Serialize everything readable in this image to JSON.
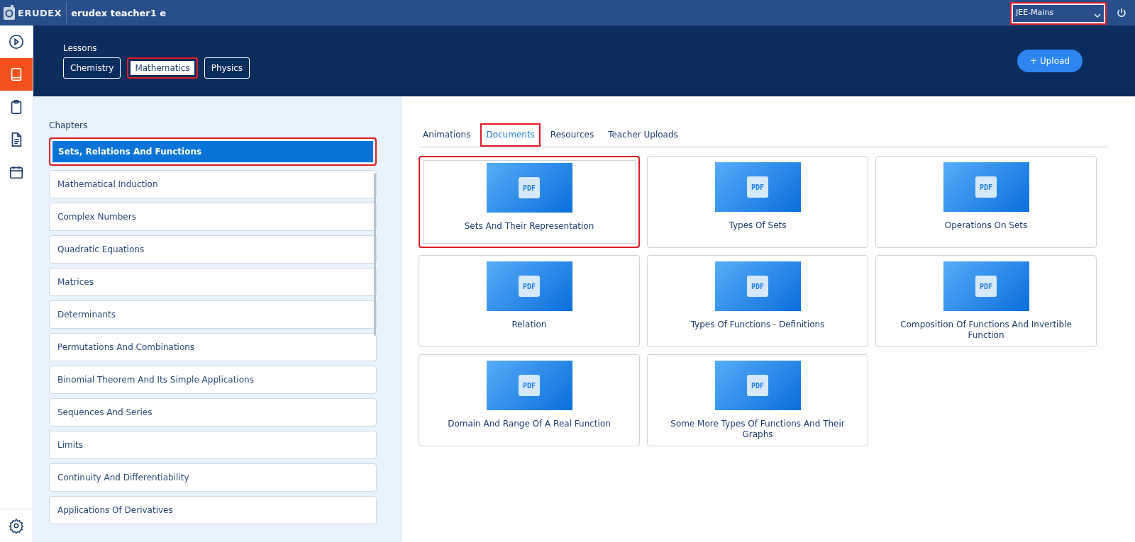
{
  "top_bar": {
    "logo": "ERUDEX",
    "user": "erudex teacher1 e",
    "exam_select": {
      "value": "JEE-Mains",
      "highlighted": true
    }
  },
  "sidebar": {
    "items": [
      {
        "kind": "play",
        "selected": false
      },
      {
        "kind": "book",
        "selected": true
      },
      {
        "kind": "clipboard",
        "selected": false
      },
      {
        "kind": "document",
        "selected": false
      },
      {
        "kind": "calendar",
        "selected": false
      }
    ]
  },
  "lessons": {
    "title": "Lessons",
    "subjects": [
      {
        "label": "Chemistry",
        "selected": false,
        "highlighted": false
      },
      {
        "label": "Mathematics",
        "selected": true,
        "highlighted": true
      },
      {
        "label": "Physics",
        "selected": false,
        "highlighted": false
      }
    ],
    "upload_button": "+ Upload"
  },
  "chapters": {
    "title": "Chapters",
    "items": [
      {
        "label": "Sets, Relations And Functions",
        "selected": true,
        "highlighted": true
      },
      {
        "label": "Mathematical Induction",
        "selected": false,
        "highlighted": false
      },
      {
        "label": "Complex Numbers",
        "selected": false,
        "highlighted": false
      },
      {
        "label": "Quadratic Equations",
        "selected": false,
        "highlighted": false
      },
      {
        "label": "Matrices",
        "selected": false,
        "highlighted": false
      },
      {
        "label": "Determinants",
        "selected": false,
        "highlighted": false
      },
      {
        "label": "Permutations And Combinations",
        "selected": false,
        "highlighted": false
      },
      {
        "label": "Binomial Theorem And Its Simple Applications",
        "selected": false,
        "highlighted": false
      },
      {
        "label": "Sequences And Series",
        "selected": false,
        "highlighted": false
      },
      {
        "label": "Limits",
        "selected": false,
        "highlighted": false
      },
      {
        "label": "Continuity And Differentiability",
        "selected": false,
        "highlighted": false
      },
      {
        "label": "Applications Of Derivatives",
        "selected": false,
        "highlighted": false
      }
    ]
  },
  "content_tabs": [
    {
      "label": "Animations",
      "selected": false,
      "highlighted": false
    },
    {
      "label": "Documents",
      "selected": true,
      "highlighted": true
    },
    {
      "label": "Resources",
      "selected": false,
      "highlighted": false
    },
    {
      "label": "Teacher Uploads",
      "selected": false,
      "highlighted": false
    }
  ],
  "documents": [
    {
      "badge": "PDF",
      "title": "Sets And Their Representation",
      "highlighted": true
    },
    {
      "badge": "PDF",
      "title": "Types Of Sets",
      "highlighted": false
    },
    {
      "badge": "PDF",
      "title": "Operations On Sets",
      "highlighted": false
    },
    {
      "badge": "PDF",
      "title": "Relation",
      "highlighted": false
    },
    {
      "badge": "PDF",
      "title": "Types Of Functions - Definitions",
      "highlighted": false
    },
    {
      "badge": "PDF",
      "title": "Composition Of Functions And Invertible Function",
      "highlighted": false
    },
    {
      "badge": "PDF",
      "title": "Domain And Range Of A Real Function",
      "highlighted": false
    },
    {
      "badge": "PDF",
      "title": "Some More Types Of Functions And Their Graphs",
      "highlighted": false
    }
  ]
}
